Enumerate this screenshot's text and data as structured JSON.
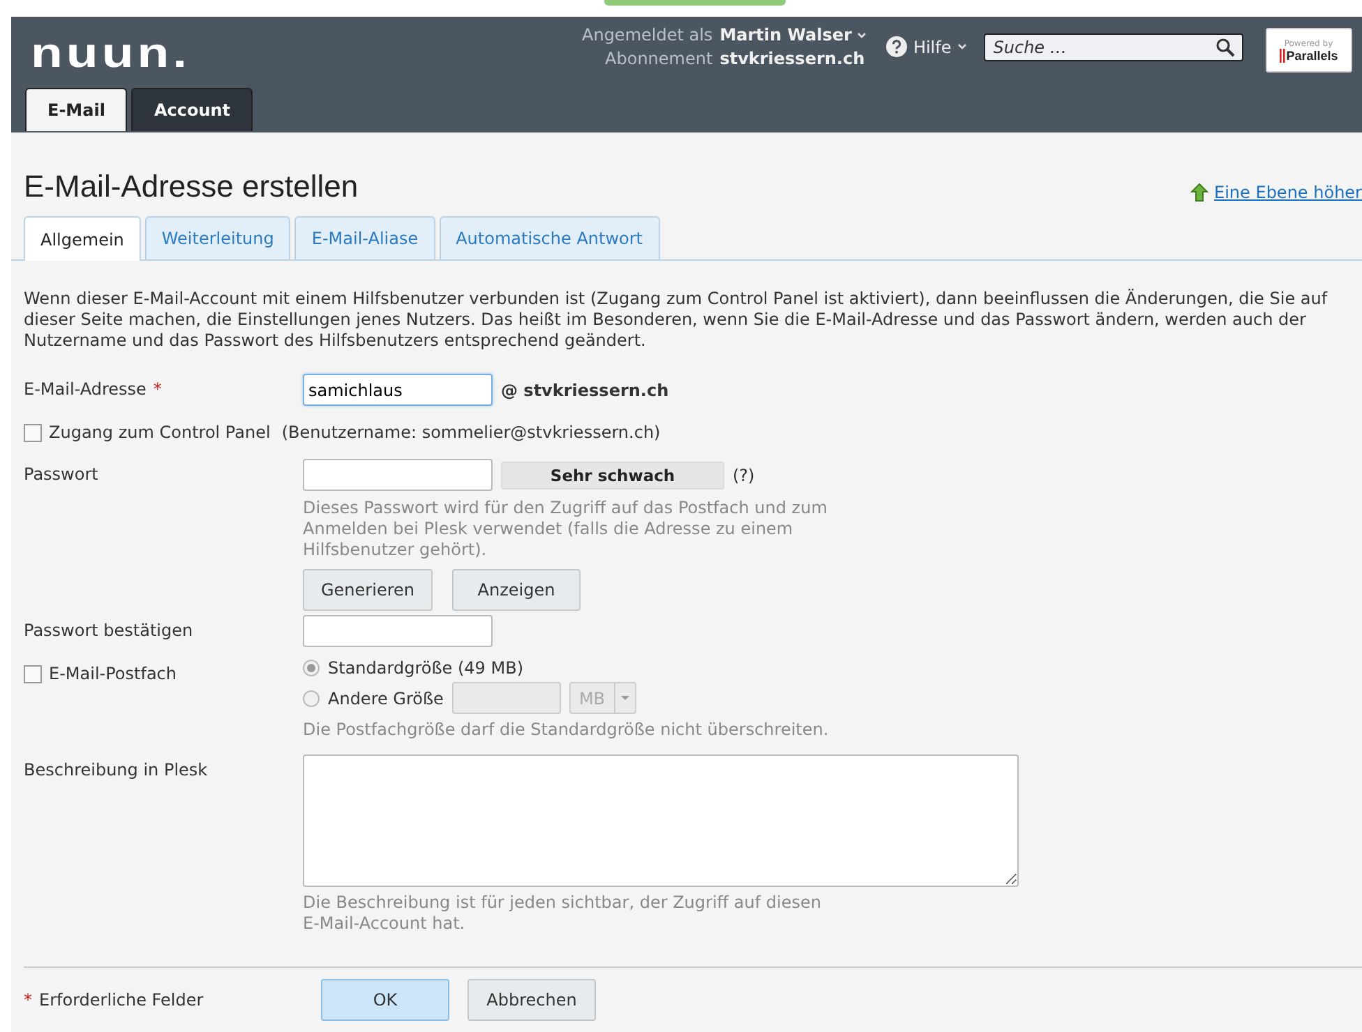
{
  "header": {
    "logo": "nuun.",
    "user": {
      "label": "Angemeldet als",
      "name": "Martin Walser",
      "subscription_label": "Abonnement",
      "subscription": "stvkriessern.ch"
    },
    "help": "Hilfe",
    "search": {
      "placeholder": "Suche …"
    },
    "badge": {
      "caption": "Powered by",
      "name": "Parallels"
    }
  },
  "main_tabs": [
    {
      "label": "E-Mail",
      "selected": true
    },
    {
      "label": "Account",
      "selected": false
    }
  ],
  "page": {
    "title": "E-Mail-Adresse erstellen",
    "up_link": "Eine Ebene höher",
    "tabs": [
      {
        "label": "Allgemein",
        "selected": true
      },
      {
        "label": "Weiterleitung",
        "selected": false
      },
      {
        "label": "E-Mail-Aliase",
        "selected": false
      },
      {
        "label": "Automatische Antwort",
        "selected": false
      }
    ],
    "intro": "Wenn dieser E-Mail-Account mit einem Hilfsbenutzer verbunden ist (Zugang zum Control Panel ist aktiviert), dann beeinflussen die Änderungen, die Sie auf dieser Seite machen, die Einstellungen jenes Nutzers. Das heißt im Besonderen, wenn Sie die E-Mail-Adresse und das Passwort ändern, werden auch der Nutzername und das Passwort des Hilfsbenutzers entsprechend geändert."
  },
  "form": {
    "email": {
      "label": "E-Mail-Adresse",
      "required_mark": "*",
      "value": "samichlaus",
      "domain": "@ stvkriessern.ch"
    },
    "control_panel": {
      "label": "Zugang zum Control Panel",
      "checked": false,
      "note": "(Benutzername: sommelier@stvkriessern.ch)"
    },
    "password": {
      "label": "Passwort",
      "strength": "Sehr schwach",
      "help": "(?)",
      "hint": "Dieses Passwort wird für den Zugriff auf das Postfach und zum Anmelden bei Plesk verwendet (falls die Adresse zu einem Hilfsbenutzer gehört).",
      "buttons": [
        "Generieren",
        "Anzeigen"
      ]
    },
    "confirm": {
      "label": "Passwort bestätigen"
    },
    "mailbox": {
      "label": "E-Mail-Postfach",
      "checked": false,
      "options": [
        {
          "label": "Standardgröße (49 MB)",
          "selected": true
        },
        {
          "label": "Andere Größe",
          "selected": false
        }
      ],
      "size_disabled": true,
      "unit": "MB",
      "hint": "Die Postfachgröße darf die Standardgröße nicht überschreiten."
    },
    "description": {
      "label": "Beschreibung in Plesk",
      "hint": "Die Beschreibung ist für jeden sichtbar, der Zugriff auf diesen E-Mail-Account hat."
    }
  },
  "footer": {
    "required_mark": "*",
    "required_note": "Erforderliche Felder",
    "buttons": [
      {
        "label": "OK",
        "kind": "primary"
      },
      {
        "label": "Abbrechen",
        "kind": "secondary"
      }
    ]
  }
}
